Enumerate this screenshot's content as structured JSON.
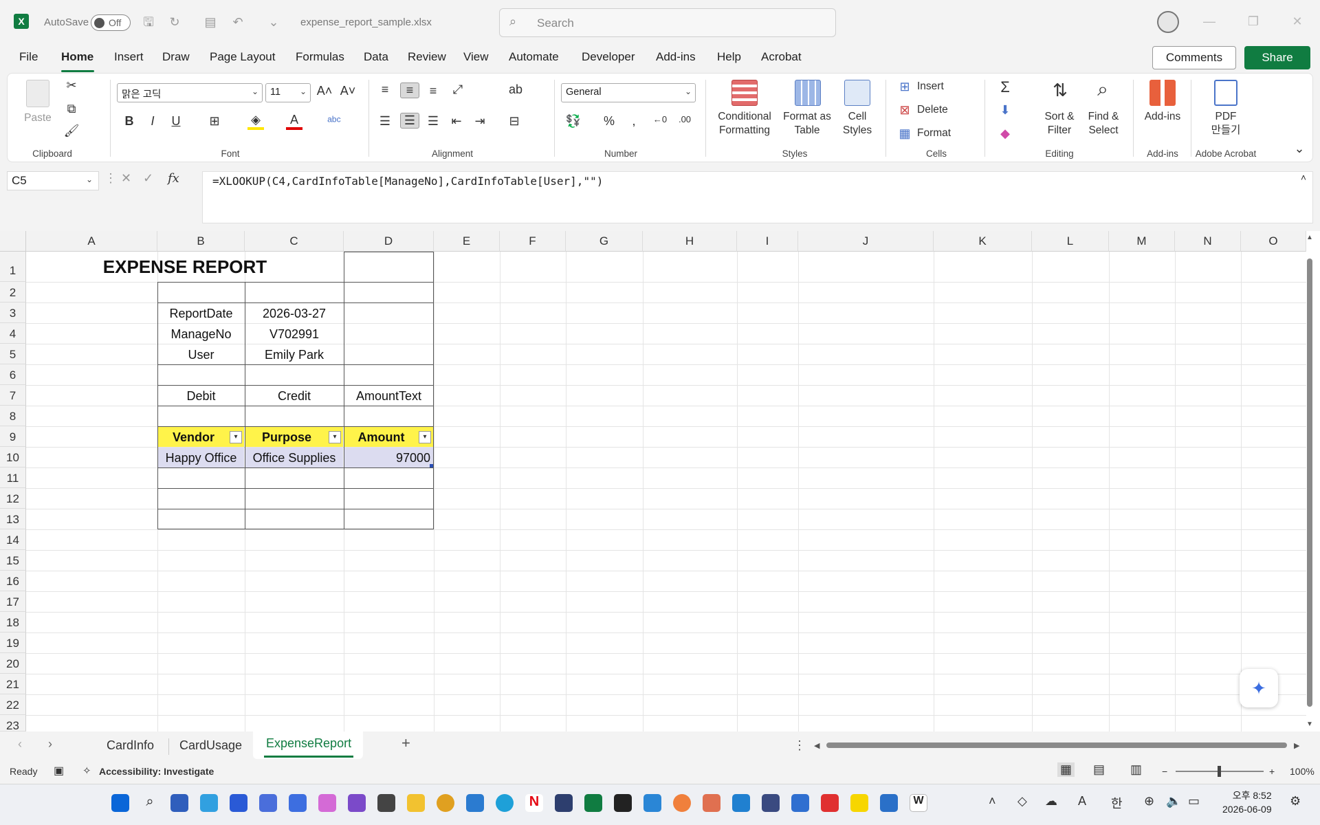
{
  "titlebar": {
    "autosave_label": "AutoSave",
    "autosave_state": "Off",
    "filename": "expense_report_sample.xlsx",
    "search_placeholder": "Search"
  },
  "menu": {
    "tabs": [
      "File",
      "Home",
      "Insert",
      "Draw",
      "Page Layout",
      "Formulas",
      "Data",
      "Review",
      "View",
      "Automate",
      "Developer",
      "Add-ins",
      "Help",
      "Acrobat"
    ],
    "active": "Home",
    "comments_label": "Comments",
    "share_label": "Share"
  },
  "ribbon": {
    "clipboard": {
      "paste": "Paste",
      "label": "Clipboard"
    },
    "font": {
      "name": "맑은 고딕",
      "size": "11",
      "label": "Font"
    },
    "alignment": {
      "label": "Alignment"
    },
    "number": {
      "format": "General",
      "label": "Number"
    },
    "styles": {
      "conditional": "Conditional",
      "conditional2": "Formatting",
      "format_as": "Format as",
      "format_as2": "Table",
      "cell": "Cell",
      "cell2": "Styles",
      "label": "Styles"
    },
    "cells": {
      "insert": "Insert",
      "delete": "Delete",
      "format": "Format",
      "label": "Cells"
    },
    "editing": {
      "sort": "Sort &",
      "sort2": "Filter",
      "find": "Find &",
      "find2": "Select",
      "label": "Editing"
    },
    "addins": {
      "btn": "Add-ins",
      "label": "Add-ins"
    },
    "acrobat": {
      "btn": "PDF",
      "btn2": "만들기",
      "label": "Adobe Acrobat"
    }
  },
  "formula_bar": {
    "cell_ref": "C5",
    "formula": "=XLOOKUP(C4,CardInfoTable[ManageNo],CardInfoTable[User],\"\")"
  },
  "grid": {
    "columns": [
      "A",
      "B",
      "C",
      "D",
      "E",
      "F",
      "G",
      "H",
      "I",
      "J",
      "K",
      "L",
      "M",
      "N",
      "O"
    ],
    "rows": [
      "1",
      "2",
      "3",
      "4",
      "5",
      "6",
      "7",
      "8",
      "9",
      "10",
      "11",
      "12",
      "13",
      "14",
      "15",
      "16",
      "17",
      "18",
      "19",
      "20",
      "21",
      "22",
      "23"
    ]
  },
  "sheet": {
    "title": "EXPENSE REPORT",
    "report_date_label": "ReportDate",
    "report_date_value": "2026-03-27",
    "manage_no_label": "ManageNo",
    "manage_no_value": "V702991",
    "user_label": "User",
    "user_value": "Emily Park",
    "debit_label": "Debit",
    "credit_label": "Credit",
    "amount_text_label": "AmountText",
    "table_headers": [
      "Vendor",
      "Purpose",
      "Amount"
    ],
    "table_rows": [
      {
        "vendor": "Happy Office",
        "purpose": "Office Supplies",
        "amount": "97000"
      }
    ]
  },
  "sheet_tabs": {
    "tabs": [
      "CardInfo",
      "CardUsage",
      "ExpenseReport"
    ],
    "active": "ExpenseReport"
  },
  "status": {
    "ready": "Ready",
    "accessibility": "Accessibility: Investigate",
    "zoom": "100%"
  },
  "taskbar": {
    "time": "오후 8:52",
    "date": "2026-06-09",
    "ime": "한"
  },
  "colors": {
    "excel_green": "#107c41",
    "table_header": "#fff34a",
    "table_row": "#dcdcf0"
  }
}
